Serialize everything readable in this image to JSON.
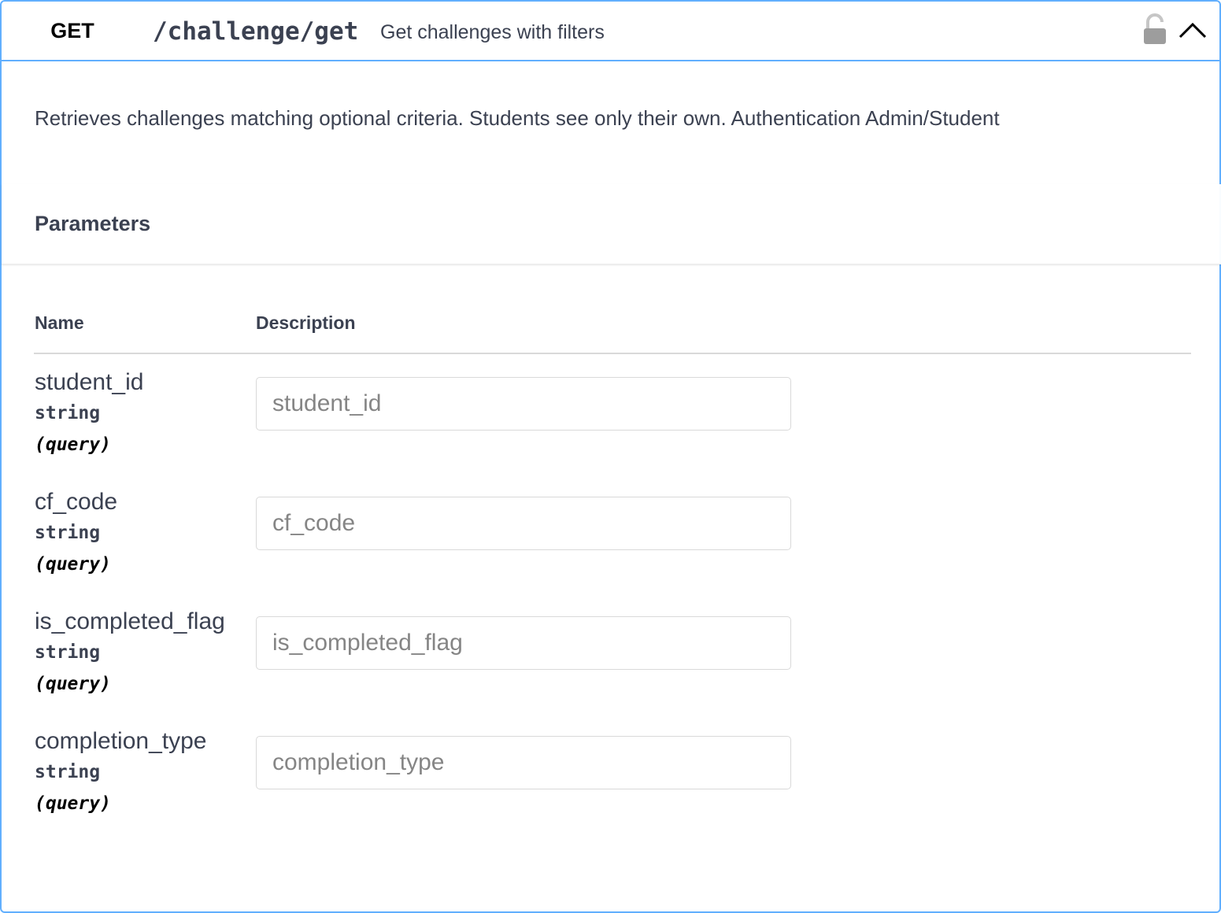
{
  "operation": {
    "method": "GET",
    "path": "/challenge/get",
    "summary": "Get challenges with filters",
    "description": "Retrieves challenges matching optional criteria. Students see only their own. Authentication Admin/Student",
    "lock_icon": "unlocked-padlock-icon",
    "chevron_icon": "chevron-up-icon",
    "accent_color": "#61affe"
  },
  "parameters": {
    "title": "Parameters",
    "columns": {
      "name": "Name",
      "description": "Description"
    },
    "items": [
      {
        "name": "student_id",
        "type": "string",
        "in": "(query)",
        "placeholder": "student_id",
        "value": ""
      },
      {
        "name": "cf_code",
        "type": "string",
        "in": "(query)",
        "placeholder": "cf_code",
        "value": ""
      },
      {
        "name": "is_completed_flag",
        "type": "string",
        "in": "(query)",
        "placeholder": "is_completed_flag",
        "value": ""
      },
      {
        "name": "completion_type",
        "type": "string",
        "in": "(query)",
        "placeholder": "completion_type",
        "value": ""
      }
    ]
  }
}
